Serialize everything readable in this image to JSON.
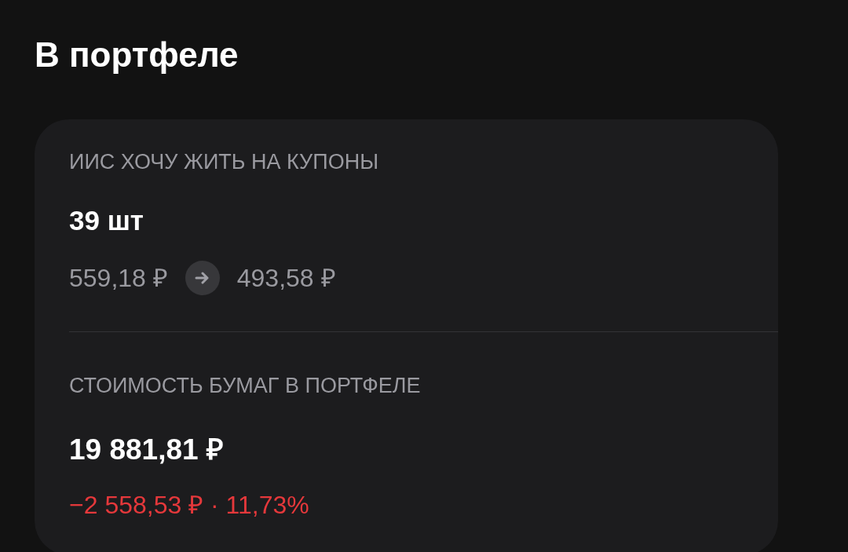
{
  "title": "В портфеле",
  "account": {
    "label": "ИИС ХОЧУ ЖИТЬ НА КУПОНЫ",
    "quantity": "39 шт",
    "price_from": "559,18 ₽",
    "price_to": "493,58 ₽"
  },
  "holdings": {
    "label": "СТОИМОСТЬ БУМАГ В ПОРТФЕЛЕ",
    "value": "19 881,81 ₽",
    "change": {
      "text": "−2 558,53 ₽ · 11,73%",
      "negative": true
    }
  }
}
